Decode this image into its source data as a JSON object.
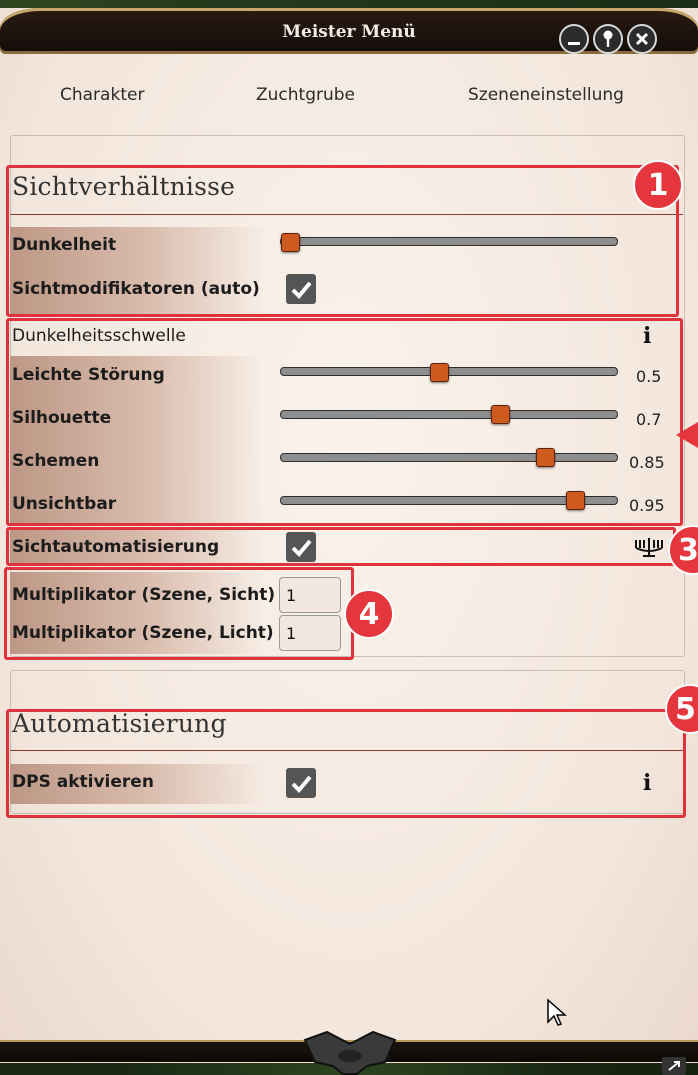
{
  "window": {
    "title": "Meister Menü"
  },
  "tabs": [
    "Charakter",
    "Zuchtgrube",
    "Szeneneinstellung"
  ],
  "sicht": {
    "title": "Sichtverhältnisse",
    "dunkelheit": {
      "label": "Dunkelheit",
      "value": 0.0
    },
    "sichtmodifikatoren": {
      "label": "Sichtmodifikatoren (auto)",
      "checked": true
    }
  },
  "schwelle": {
    "title": "Dunkelheitsschwelle",
    "info": "i",
    "sliders": [
      {
        "label": "Leichte Störung",
        "value": "0.5"
      },
      {
        "label": "Silhouette",
        "value": "0.7"
      },
      {
        "label": "Schemen",
        "value": "0.85"
      },
      {
        "label": "Unsichtbar",
        "value": "0.95"
      }
    ]
  },
  "sichtautomatisierung": {
    "label": "Sichtautomatisierung",
    "checked": true
  },
  "multiplikator": {
    "sicht": {
      "label": "Multiplikator (Szene, Sicht)",
      "value": "1"
    },
    "licht": {
      "label": "Multiplikator (Szene, Licht)",
      "value": "1"
    }
  },
  "automatisierung": {
    "title": "Automatisierung",
    "dps": {
      "label": "DPS aktivieren",
      "checked": true,
      "info": "i"
    }
  },
  "badges": [
    "1",
    "3",
    "4",
    "5"
  ],
  "colors": {
    "highlight": "#e0323c",
    "thumb": "#cf5a1e",
    "accent_line": "#8d3a2a"
  }
}
